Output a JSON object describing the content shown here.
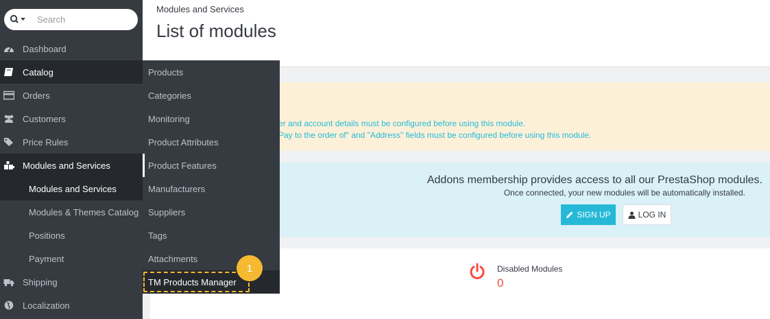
{
  "search": {
    "placeholder": "Search"
  },
  "sidebar": {
    "items": [
      {
        "label": "Dashboard",
        "icon": "dashboard-icon"
      },
      {
        "label": "Catalog",
        "icon": "book-icon"
      },
      {
        "label": "Orders",
        "icon": "credit-card-icon"
      },
      {
        "label": "Customers",
        "icon": "users-icon"
      },
      {
        "label": "Price Rules",
        "icon": "tags-icon"
      },
      {
        "label": "Modules and Services",
        "icon": "puzzle-icon"
      },
      {
        "label": "Shipping",
        "icon": "truck-icon"
      },
      {
        "label": "Localization",
        "icon": "globe-icon"
      }
    ],
    "sub_items": [
      "Modules and Services",
      "Modules & Themes Catalog",
      "Positions",
      "Payment"
    ]
  },
  "flyout": {
    "items": [
      "Products",
      "Categories",
      "Monitoring",
      "Product Attributes",
      "Product Features",
      "Manufacturers",
      "Suppliers",
      "Tags",
      "Attachments",
      "TM Products Manager"
    ]
  },
  "header": {
    "breadcrumb": "Modules and Services",
    "title": "List of modules"
  },
  "warning": {
    "line1": "er and account details must be configured before using this module.",
    "line2": "Pay to the order of\" and \"Address\" fields must be configured before using this module."
  },
  "addons": {
    "heading": "Addons membership provides access to all our PrestaShop modules.",
    "subheading": "Once connected, your new modules will be automatically installed.",
    "signup_label": "SIGN UP",
    "login_label": "LOG IN"
  },
  "stats": {
    "disabled_label": "Disabled Modules",
    "disabled_value": "0"
  },
  "callout": {
    "number": "1"
  },
  "colors": {
    "accent": "#25b9d7",
    "sidebar": "#363a41",
    "highlight": "#f5b932",
    "danger": "#f54c3e"
  }
}
